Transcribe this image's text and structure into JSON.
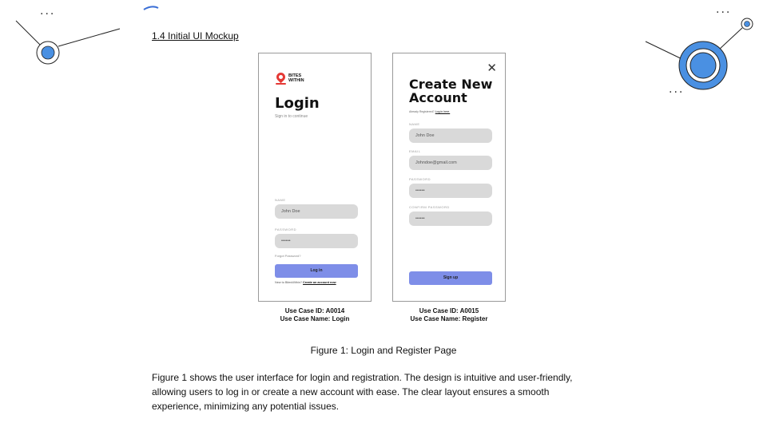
{
  "section": {
    "title": "1.4 Initial UI Mockup"
  },
  "decor": {
    "dots": "..."
  },
  "login_mock": {
    "logo_line1": "BITES",
    "logo_line2": "WITHIN",
    "title": "Login",
    "subtitle": "Sign in to continue",
    "name_label": "NAME",
    "name_value": "John Doe",
    "password_label": "PASSWORD",
    "password_value": "••••••",
    "forgot": "Forgot Password?",
    "button": "Log in",
    "new_to": "New to BitesWithin?",
    "create_link": "Create an account now"
  },
  "register_mock": {
    "close": "✕",
    "title_line1": "Create New",
    "title_line2": "Account",
    "already": "Already Registered?",
    "login_link": "Log in here.",
    "name_label": "NAME",
    "name_value": "John Doe",
    "email_label": "EMAIL",
    "email_value": "Johndoe@gmail.com",
    "password_label": "PASSWORD",
    "password_value": "••••••",
    "confirm_label": "CONFIRM PASSWORD",
    "confirm_value": "••••••",
    "button": "Sign up"
  },
  "use_cases": {
    "left_id": "Use Case ID: A0014",
    "left_name": "Use Case Name: Login",
    "right_id": "Use Case ID: A0015",
    "right_name": "Use Case Name: Register"
  },
  "caption": "Figure 1: Login and Register Page",
  "paragraph": "Figure 1 shows the user interface for login and registration. The design is intuitive and user-friendly, allowing users to log in or create a new account with ease. The clear layout ensures a smooth experience, minimizing any potential issues.",
  "colors": {
    "accent": "#4a90e2",
    "button": "#7e8ee8",
    "field": "#d9d9d9",
    "pin": "#e53935"
  }
}
